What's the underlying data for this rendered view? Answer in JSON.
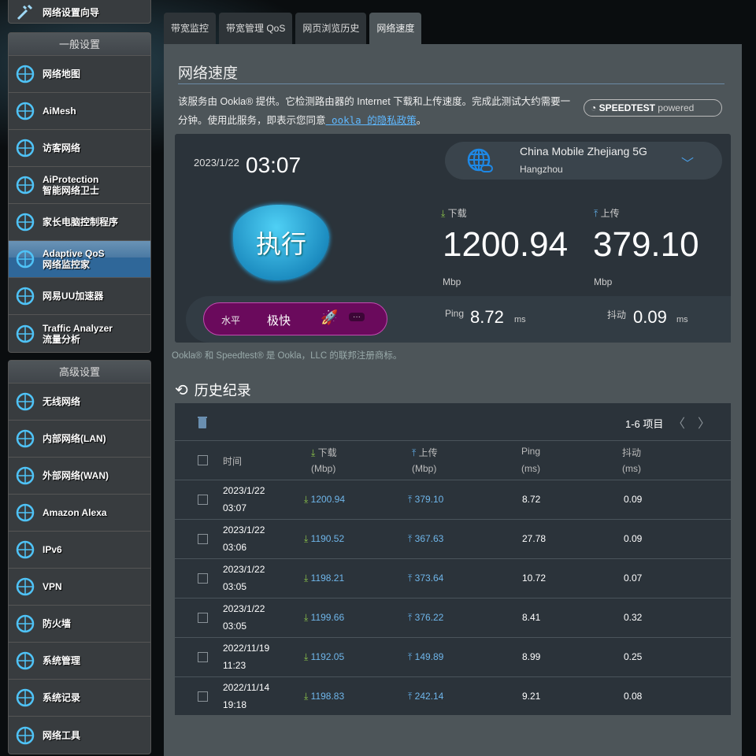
{
  "sidebar": {
    "top_item": "网络设置向导",
    "general_header": "一般设置",
    "general": [
      {
        "icon": "network-map-icon",
        "l1": "网络地图",
        "l2": ""
      },
      {
        "icon": "aimesh-icon",
        "l1": "AiMesh",
        "l2": ""
      },
      {
        "icon": "guest-network-icon",
        "l1": "访客网络",
        "l2": ""
      },
      {
        "icon": "shield-lock-icon",
        "l1": "AiProtection",
        "l2": "智能网络卫士"
      },
      {
        "icon": "parental-control-icon",
        "l1": "家长电脑控制程序",
        "l2": ""
      },
      {
        "icon": "speedometer-icon",
        "l1": "Adaptive QoS",
        "l2": "网络监控家"
      },
      {
        "icon": "speedometer-icon",
        "l1": "网易UU加速器",
        "l2": ""
      },
      {
        "icon": "traffic-analyzer-icon",
        "l1": "Traffic Analyzer",
        "l2": "流量分析"
      }
    ],
    "advanced_header": "高级设置",
    "advanced": [
      {
        "icon": "wireless-icon",
        "l1": "无线网络"
      },
      {
        "icon": "lan-icon",
        "l1": "内部网络(LAN)"
      },
      {
        "icon": "globe-icon",
        "l1": "外部网络(WAN)"
      },
      {
        "icon": "alexa-icon",
        "l1": "Amazon Alexa"
      },
      {
        "icon": "ipv6-icon",
        "l1": "IPv6"
      },
      {
        "icon": "vpn-icon",
        "l1": "VPN"
      },
      {
        "icon": "firewall-icon",
        "l1": "防火墙"
      },
      {
        "icon": "admin-gear-icon",
        "l1": "系统管理"
      },
      {
        "icon": "system-log-icon",
        "l1": "系统记录"
      },
      {
        "icon": "network-tools-icon",
        "l1": "网络工具"
      }
    ]
  },
  "tabs": [
    "带宽监控",
    "带宽管理 QoS",
    "网页浏览历史",
    "网络速度"
  ],
  "page": {
    "title": "网络速度",
    "desc": "该服务由 Ookla® 提供。它检测路由器的 Internet 下载和上传速度。完成此测试大约需要一分钟。使用此服务，即表示您同意",
    "link": " ookla 的隐私政策",
    "desc_end": "。",
    "badge_bold": "SPEEDTEST",
    "badge_light": "powered",
    "footnote": "Ookla® 和 Speedtest® 是 Ookla，LLC 的联邦注册商标。",
    "history_title": "历史纪录"
  },
  "result": {
    "date": "2023/1/22",
    "time": "03:07",
    "isp": "China Mobile Zhejiang 5G",
    "city": "Hangzhou",
    "go": "执行",
    "download_label": "下载",
    "upload_label": "上传",
    "download": "1200.94",
    "upload": "379.10",
    "unit": "Mbp",
    "level_label": "水平",
    "level": "极快",
    "more": "···",
    "ping_label": "Ping",
    "ping": "8.72",
    "jitter_label": "抖动",
    "jitter": "0.09",
    "ms": "ms"
  },
  "table": {
    "paging": "1-6 项目",
    "headers": {
      "time": "时间",
      "down": "下载",
      "up": "上传",
      "ping": "Ping",
      "jitter": "抖动",
      "mbp": "(Mbp)",
      "ms": "(ms)"
    },
    "rows": [
      {
        "d": "2023/1/22",
        "t": "03:07",
        "down": "1200.94",
        "up": "379.10",
        "ping": "8.72",
        "jitter": "0.09"
      },
      {
        "d": "2023/1/22",
        "t": "03:06",
        "down": "1190.52",
        "up": "367.63",
        "ping": "27.78",
        "jitter": "0.09"
      },
      {
        "d": "2023/1/22",
        "t": "03:05",
        "down": "1198.21",
        "up": "373.64",
        "ping": "10.72",
        "jitter": "0.07"
      },
      {
        "d": "2023/1/22",
        "t": "03:05",
        "down": "1199.66",
        "up": "376.22",
        "ping": "8.41",
        "jitter": "0.32"
      },
      {
        "d": "2022/11/19",
        "t": "11:23",
        "down": "1192.05",
        "up": "149.89",
        "ping": "8.99",
        "jitter": "0.25"
      },
      {
        "d": "2022/11/14",
        "t": "19:18",
        "down": "1198.83",
        "up": "242.14",
        "ping": "9.21",
        "jitter": "0.08"
      }
    ]
  },
  "colors": {
    "accent": "#4fc3f7",
    "download": "#8bc34a",
    "upload": "#5fa8e0",
    "pill": "#6a0a5c"
  }
}
